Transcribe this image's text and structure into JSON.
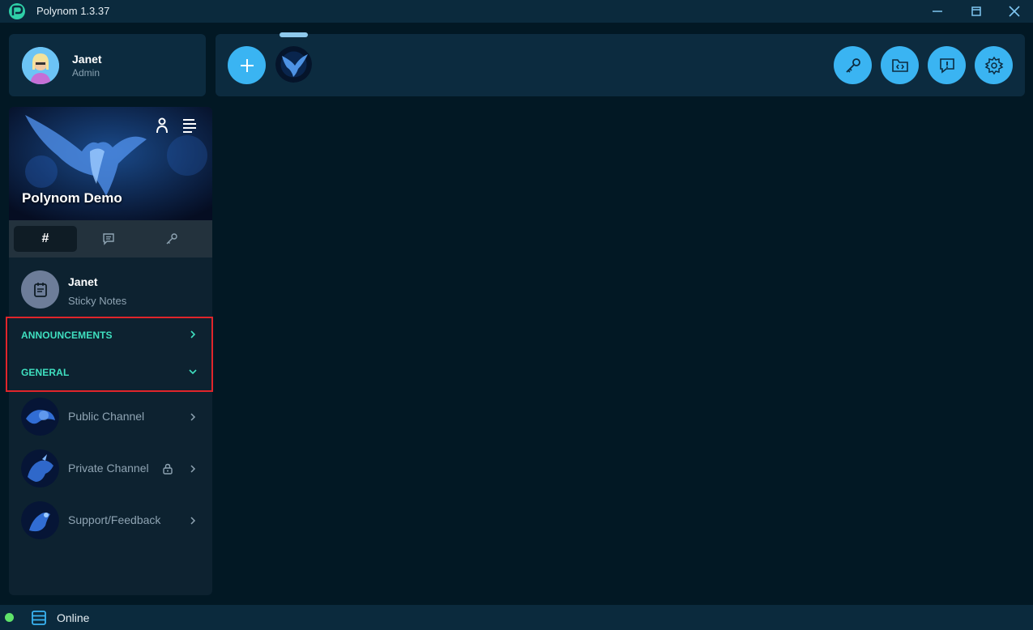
{
  "window": {
    "title": "Polynom 1.3.37",
    "controls": [
      "minimize",
      "maximize",
      "close"
    ]
  },
  "user": {
    "name": "Janet",
    "role": "Admin"
  },
  "toolbar": {
    "buttons": [
      "add-server-icon",
      "key-icon",
      "code-folder-icon",
      "feedback-icon",
      "settings-icon"
    ]
  },
  "server": {
    "name": "Polynom Demo",
    "tabs": [
      "#",
      "chat-icon",
      "key-icon"
    ]
  },
  "sticky_notes": {
    "title": "Janet",
    "subtitle": "Sticky Notes"
  },
  "categories": [
    {
      "label": "ANNOUNCEMENTS",
      "state": "collapsed"
    },
    {
      "label": "GENERAL",
      "state": "expanded"
    }
  ],
  "channels": [
    {
      "name": "Public Channel",
      "locked": false
    },
    {
      "name": "Private Channel",
      "locked": true
    },
    {
      "name": "Support/Feedback",
      "locked": false
    }
  ],
  "status": {
    "text": "Online",
    "color": "#5fe36a"
  },
  "colors": {
    "accent": "#3ab4f2",
    "category": "#3fe0c0",
    "highlight": "#e0252b"
  }
}
